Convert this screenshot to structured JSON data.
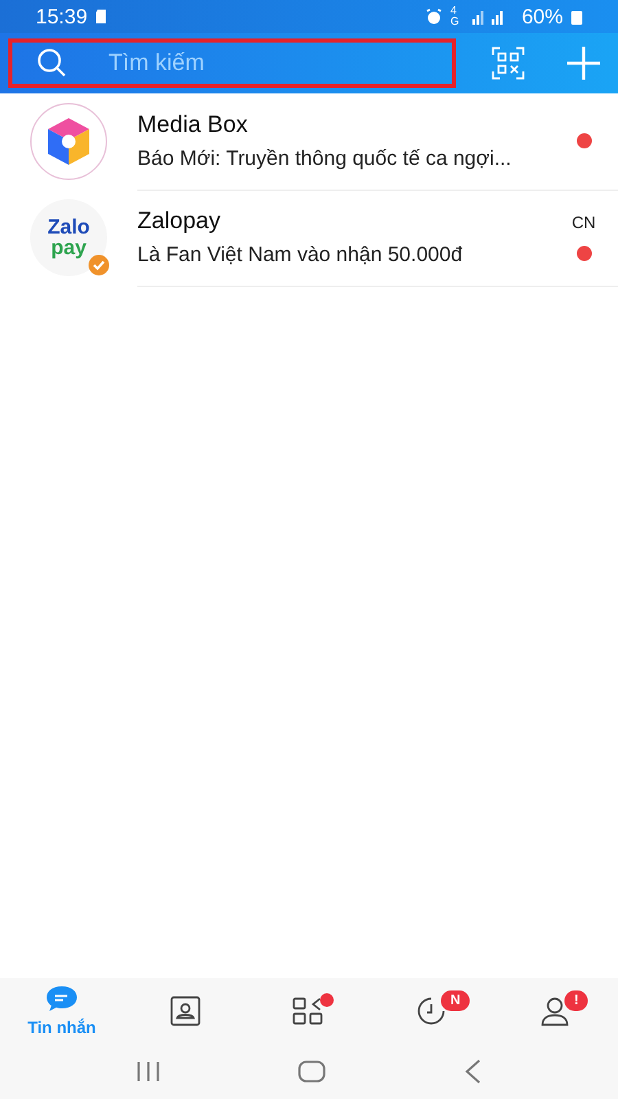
{
  "status_bar": {
    "time": "15:39",
    "network": "4G",
    "battery": "60%"
  },
  "search": {
    "placeholder": "Tìm kiếm",
    "highlighted": true
  },
  "conversations": [
    {
      "name": "Media Box",
      "preview": "Báo Mới: Truyền thông quốc tế ca ngợi...",
      "avatar": {
        "kind": "cube"
      },
      "verified": false,
      "unread": true
    },
    {
      "name": "Zalopay",
      "preview": "Là Fan Việt Nam vào nhận 50.000đ",
      "time": "CN",
      "avatar": {
        "kind": "wordmark",
        "lines": [
          "Zalo",
          "pay"
        ]
      },
      "verified": true,
      "unread": true
    }
  ],
  "tabs": [
    {
      "kind": "chat",
      "label": "Tin nhắn",
      "selected": true
    },
    {
      "kind": "contacts",
      "selected": false
    },
    {
      "kind": "apps",
      "selected": false,
      "dot": true
    },
    {
      "kind": "clock",
      "selected": false,
      "badge": "N"
    },
    {
      "kind": "person",
      "selected": false,
      "badge": "!"
    }
  ]
}
